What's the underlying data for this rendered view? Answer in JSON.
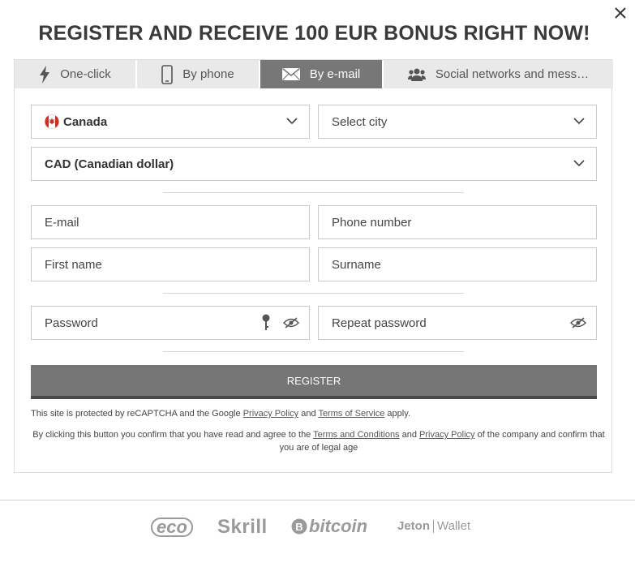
{
  "header": {
    "title": "REGISTER AND RECEIVE 100 EUR BONUS RIGHT NOW!"
  },
  "tabs": [
    {
      "label": "One-click",
      "icon": "lightning-icon"
    },
    {
      "label": "By phone",
      "icon": "phone-icon"
    },
    {
      "label": "By e-mail",
      "icon": "envelope-icon",
      "active": true
    },
    {
      "label": "Social networks and mess…",
      "icon": "users-icon"
    }
  ],
  "form": {
    "country_value": "Canada",
    "city_placeholder": "Select city",
    "currency_value": "CAD (Canadian dollar)",
    "email_placeholder": "E-mail",
    "phone_placeholder": "Phone number",
    "first_name_placeholder": "First name",
    "surname_placeholder": "Surname",
    "password_placeholder": "Password",
    "repeat_password_placeholder": "Repeat password",
    "register_label": "REGISTER"
  },
  "legal": {
    "recaptcha_prefix": "This site is protected by reCAPTCHA and the Google",
    "privacy_policy": "Privacy Policy",
    "and": "and",
    "terms_of_service": "Terms of Service",
    "apply": "apply.",
    "confirm_prefix": "By clicking this button you confirm that you have read and agree to the",
    "terms_and_conditions": "Terms and Conditions",
    "confirm_suffix": "of the company and confirm that you are of legal age"
  },
  "payments": [
    {
      "label": "eco",
      "icon": "eco-logo"
    },
    {
      "label": "Skrill",
      "icon": "skrill-logo"
    },
    {
      "label": "bitcoin",
      "icon": "bitcoin-logo"
    },
    {
      "label": "Jeton",
      "suffix": "Wallet",
      "icon": "jeton-wallet-logo"
    }
  ],
  "colors": {
    "active_tab": "#777777",
    "tab_bg": "#e9e9e9",
    "button": "#757575",
    "canada_red": "#d52b1e"
  }
}
